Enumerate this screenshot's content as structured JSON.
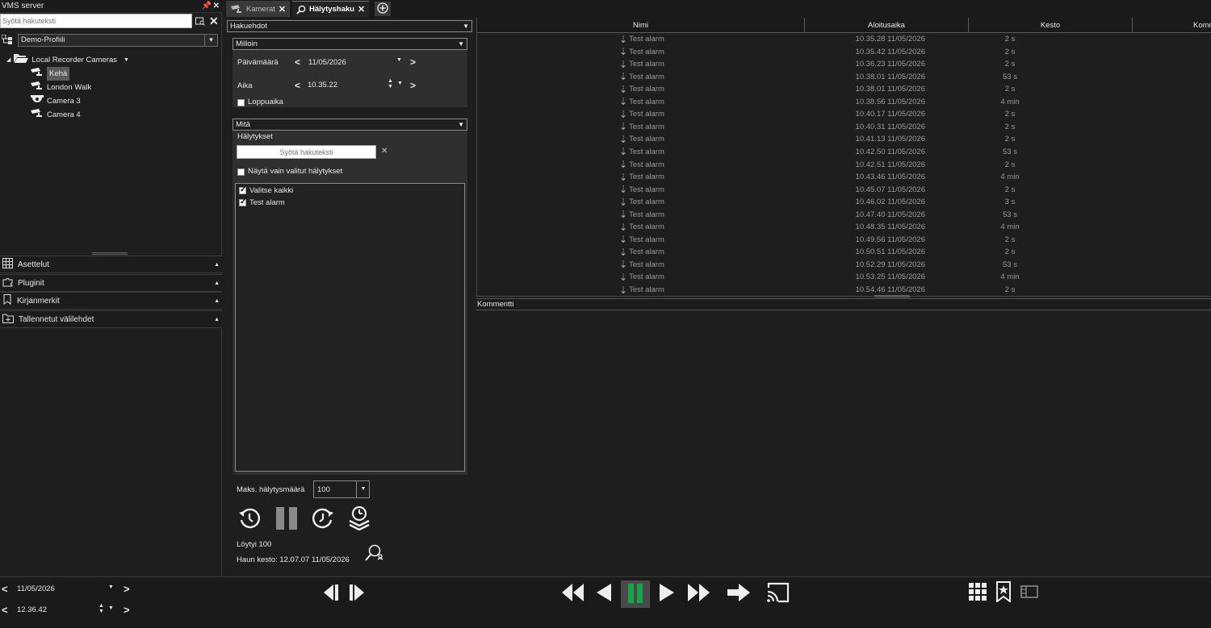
{
  "app": {
    "title": "VMS server"
  },
  "left": {
    "search_placeholder": "Syötä hakuteksti",
    "profile": "Demo-Profiili",
    "tree": {
      "root": "Local Recorder Cameras",
      "cameras": [
        "Kehä",
        "London Walk",
        "Camera 3",
        "Camera 4"
      ]
    },
    "accordion": [
      "Asettelut",
      "Pluginit",
      "Kirjanmerkit",
      "Tallennetut välilehdet"
    ],
    "date": "11/05/2026",
    "time": "12.36.42"
  },
  "tabs": [
    {
      "label": "Kamerat",
      "active": false
    },
    {
      "label": "Hälytyshaku",
      "active": true
    }
  ],
  "search": {
    "header": "Hakuehdot",
    "when": {
      "header": "Milloin",
      "date_label": "Päivämäärä",
      "date_value": "11/05/2026",
      "time_label": "Aika",
      "time_value": "10.35.22",
      "end_time_label": "Loppuaika",
      "end_time_checked": false
    },
    "what": {
      "header": "Mitä",
      "alarms_label": "Hälytykset",
      "search_placeholder": "Syötä hakuteksti",
      "only_selected_label": "Näytä vain valitut hälytykset",
      "only_selected_checked": false,
      "list": [
        {
          "label": "Valitse kaikki",
          "checked": true
        },
        {
          "label": "Test alarm",
          "checked": true
        }
      ]
    },
    "max_label": "Maks. hälytysmäärä",
    "max_value": "100",
    "found": "Löytyi 100",
    "duration": "Haun kesto: 12.07.07  11/05/2026"
  },
  "table": {
    "columns": [
      "Nimi",
      "Aloitusaika",
      "Kesto",
      "Komm"
    ],
    "rows": [
      {
        "name": "Test alarm",
        "start": "10.35.28  11/05/2026",
        "duration": "2 s"
      },
      {
        "name": "Test alarm",
        "start": "10.35.42  11/05/2026",
        "duration": "2 s"
      },
      {
        "name": "Test alarm",
        "start": "10.36.23  11/05/2026",
        "duration": "2 s"
      },
      {
        "name": "Test alarm",
        "start": "10.38.01  11/05/2026",
        "duration": "53 s"
      },
      {
        "name": "Test alarm",
        "start": "10.38.01  11/05/2026",
        "duration": "2 s"
      },
      {
        "name": "Test alarm",
        "start": "10.38.56  11/05/2026",
        "duration": "4 min"
      },
      {
        "name": "Test alarm",
        "start": "10.40.17  11/05/2026",
        "duration": "2 s"
      },
      {
        "name": "Test alarm",
        "start": "10.40.31  11/05/2026",
        "duration": "2 s"
      },
      {
        "name": "Test alarm",
        "start": "10.41.13  11/05/2026",
        "duration": "2 s"
      },
      {
        "name": "Test alarm",
        "start": "10.42.50  11/05/2026",
        "duration": "53 s"
      },
      {
        "name": "Test alarm",
        "start": "10.42.51  11/05/2026",
        "duration": "2 s"
      },
      {
        "name": "Test alarm",
        "start": "10.43.46  11/05/2026",
        "duration": "4 min"
      },
      {
        "name": "Test alarm",
        "start": "10.45.07  11/05/2026",
        "duration": "2 s"
      },
      {
        "name": "Test alarm",
        "start": "10.46.02  11/05/2026",
        "duration": "3 s"
      },
      {
        "name": "Test alarm",
        "start": "10.47.40  11/05/2026",
        "duration": "53 s"
      },
      {
        "name": "Test alarm",
        "start": "10.48.35  11/05/2026",
        "duration": "4 min"
      },
      {
        "name": "Test alarm",
        "start": "10.49.56  11/05/2026",
        "duration": "2 s"
      },
      {
        "name": "Test alarm",
        "start": "10.50.51  11/05/2026",
        "duration": "2 s"
      },
      {
        "name": "Test alarm",
        "start": "10.52.29  11/05/2026",
        "duration": "53 s"
      },
      {
        "name": "Test alarm",
        "start": "10.53.25  11/05/2026",
        "duration": "4 min"
      },
      {
        "name": "Test alarm",
        "start": "10.54.46  11/05/2026",
        "duration": "2 s"
      }
    ]
  },
  "comment_header": "Kommentti",
  "colors": {
    "background": "#1e1e1e",
    "panel": "#2f2f2f",
    "play_active": "#1aa34a"
  }
}
